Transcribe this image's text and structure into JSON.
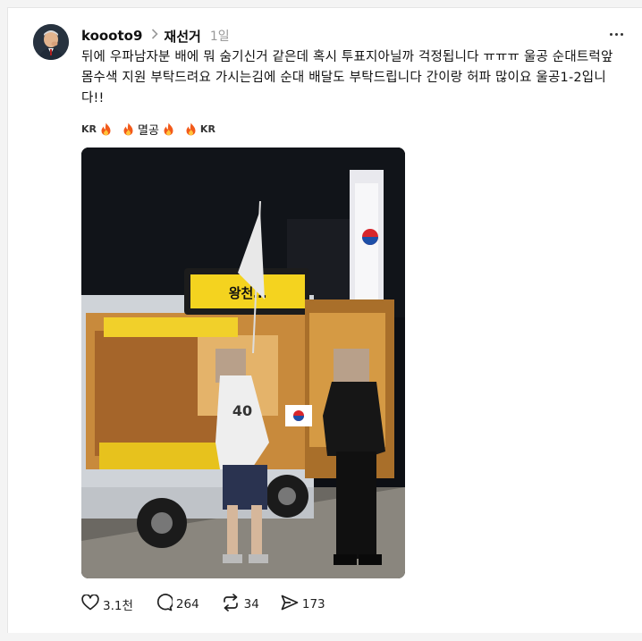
{
  "post": {
    "username": "koooto9",
    "topic": "재선거",
    "time": "1일",
    "body": "뒤에 우파남자분 배에 뭐 숨기신거 같은데 혹시 투표지아닐까 걱정됩니다 ㅠㅠㅠ 울공 순대트럭앞 몸수색 지원 부탁드려요 가시는김에 순대 배달도 부탁드립니다 간이랑 허파 많이요 울공1-2입니다!!",
    "tags": [
      "KR",
      "멸공",
      "KR"
    ],
    "icons": [
      "more-icon",
      "chevron-right-icon",
      "fire-icon",
      "heart-icon",
      "comment-icon",
      "repost-icon",
      "share-icon"
    ]
  },
  "photo": {
    "truck_sign_text": "왕천…",
    "sticker_text": "40"
  },
  "actions": {
    "likes": "3.1천",
    "comments": "264",
    "reposts": "34",
    "shares": "173"
  },
  "colors": {
    "accent": "#101010",
    "muted": "#999999",
    "fire": "#f25a1a"
  }
}
